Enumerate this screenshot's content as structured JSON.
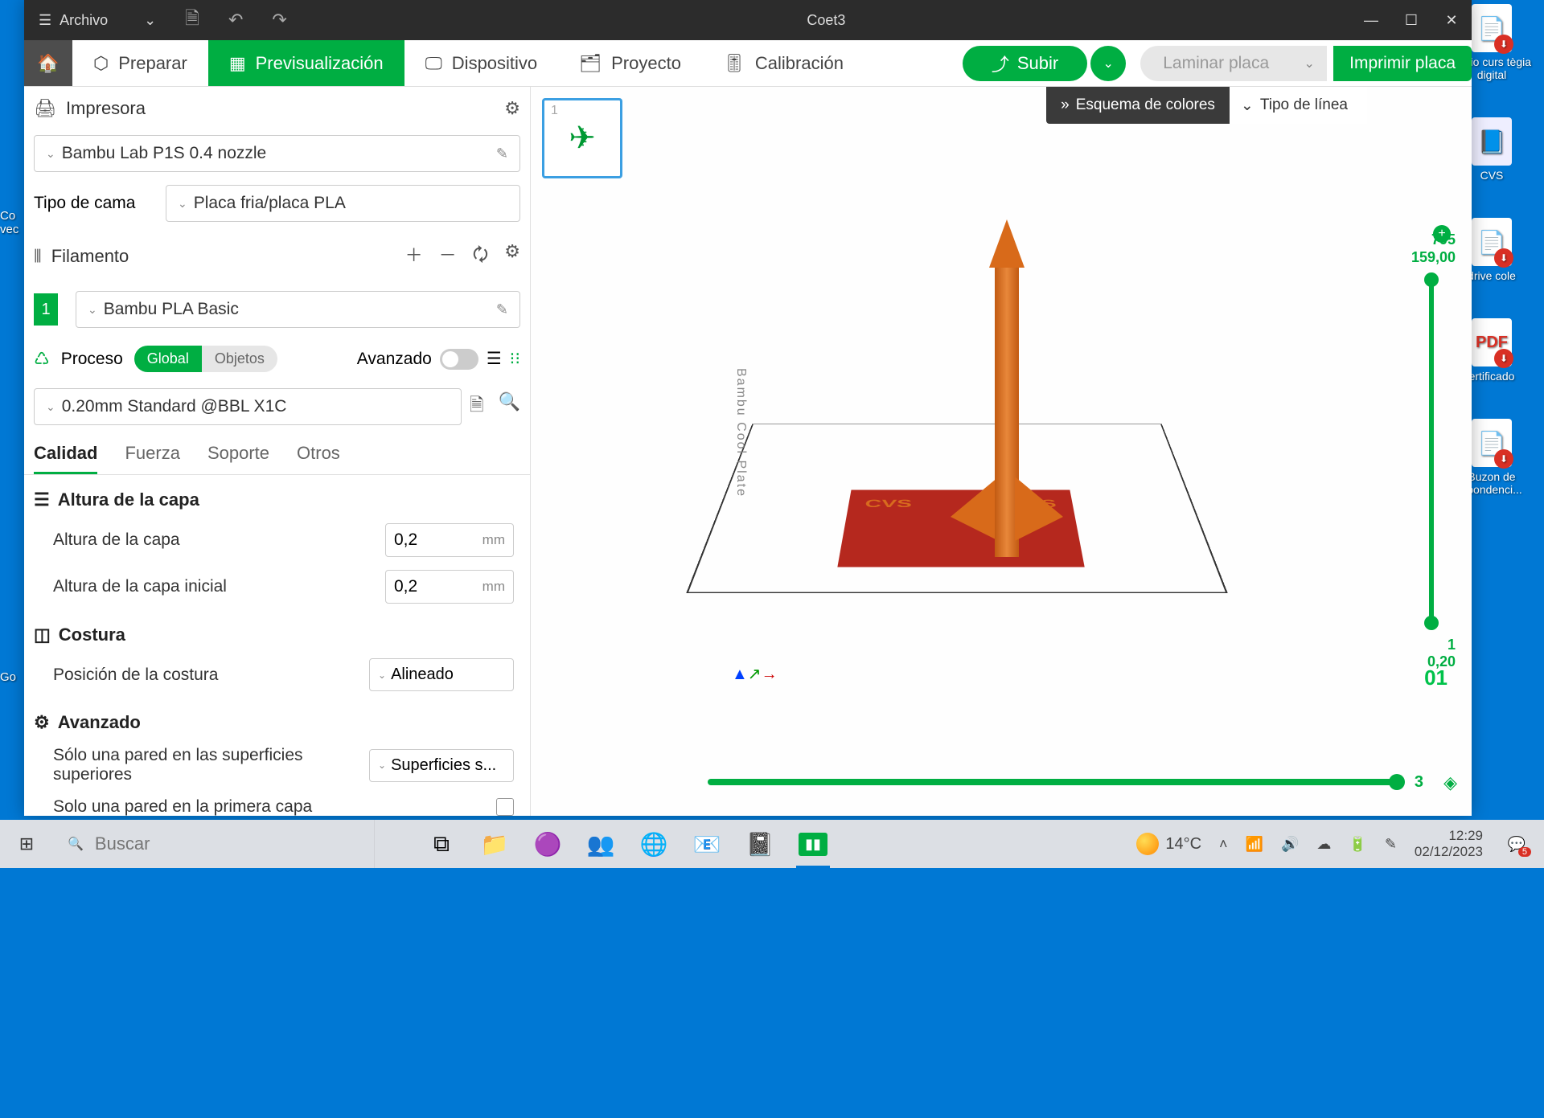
{
  "desktop": {
    "icons": [
      {
        "label": "ripcio curs\ntègia digital",
        "type": "pdf"
      },
      {
        "label": "CVS",
        "type": "doc"
      },
      {
        "label": "drive cole",
        "type": "pdf"
      },
      {
        "label": "ertificado",
        "type": "pdf"
      },
      {
        "label": "Buzon de\nspondenci...",
        "type": "pdf"
      }
    ],
    "left_partial": [
      "Co\nvec",
      "Go"
    ]
  },
  "titlebar": {
    "menu": "Archivo",
    "title": "Coet3"
  },
  "toolbar": {
    "home_icon": "home",
    "tabs": [
      {
        "icon": "⬡",
        "label": "Preparar"
      },
      {
        "icon": "▦",
        "label": "Previsualización",
        "active": true
      },
      {
        "icon": "🖵",
        "label": "Dispositivo"
      },
      {
        "icon": "🗂",
        "label": "Proyecto"
      },
      {
        "icon": "⚙",
        "label": "Calibración"
      }
    ],
    "upload": "Subir",
    "slice": "Laminar placa",
    "print": "Imprimir placa"
  },
  "sidebar": {
    "printer_hdr": "Impresora",
    "printer": "Bambu Lab P1S 0.4 nozzle",
    "bed_label": "Tipo de cama",
    "bed": "Placa fria/placa PLA",
    "filament_hdr": "Filamento",
    "filament_num": "1",
    "filament": "Bambu PLA Basic",
    "process_hdr": "Proceso",
    "global": "Global",
    "objects": "Objetos",
    "advanced": "Avanzado",
    "preset": "0.20mm Standard @BBL X1C",
    "tabs": [
      "Calidad",
      "Fuerza",
      "Soporte",
      "Otros"
    ],
    "g_layer": "Altura de la capa",
    "p_layer": "Altura de la capa",
    "v_layer": "0,2",
    "p_first": "Altura de la capa inicial",
    "v_first": "0,2",
    "unit": "mm",
    "g_seam": "Costura",
    "p_seam": "Posición de la costura",
    "v_seam": "Alineado",
    "g_adv": "Avanzado",
    "p_onewall_top": "Sólo una pared en las superficies superiores",
    "v_onewall_top": "Superficies s...",
    "p_onewall_first": "Solo una pared en la primera capa"
  },
  "viewport": {
    "thumb_num": "1",
    "scheme_label": "Esquema de colores",
    "scheme_value": "Tipo de línea",
    "plate_text": "Bambu Cool Plate",
    "pad_text": "CVS",
    "marker": "01",
    "slider_top_a": "795",
    "slider_top_b": "159,00",
    "slider_bot_a": "1",
    "slider_bot_b": "0,20",
    "hslider_val": "3"
  },
  "taskbar": {
    "search_placeholder": "Buscar",
    "weather": "14°C",
    "time": "12:29",
    "date": "02/12/2023",
    "notif_count": "5"
  }
}
